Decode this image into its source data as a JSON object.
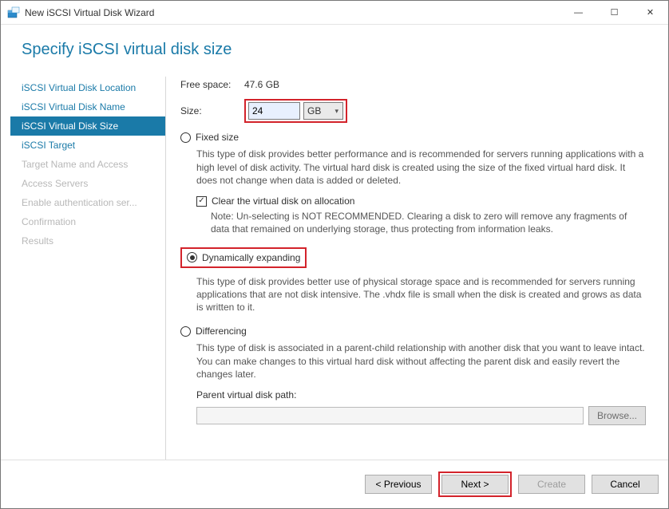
{
  "window": {
    "title": "New iSCSI Virtual Disk Wizard"
  },
  "page": {
    "heading": "Specify iSCSI virtual disk size"
  },
  "sidebar": {
    "items": [
      {
        "label": "iSCSI Virtual Disk Location",
        "state": "enabled"
      },
      {
        "label": "iSCSI Virtual Disk Name",
        "state": "enabled"
      },
      {
        "label": "iSCSI Virtual Disk Size",
        "state": "selected"
      },
      {
        "label": "iSCSI Target",
        "state": "enabled"
      },
      {
        "label": "Target Name and Access",
        "state": "disabled"
      },
      {
        "label": "Access Servers",
        "state": "disabled"
      },
      {
        "label": "Enable authentication ser...",
        "state": "disabled"
      },
      {
        "label": "Confirmation",
        "state": "disabled"
      },
      {
        "label": "Results",
        "state": "disabled"
      }
    ]
  },
  "main": {
    "free_space_label": "Free space:",
    "free_space_value": "47.6 GB",
    "size_label": "Size:",
    "size_value": "24",
    "size_unit": "GB",
    "fixed": {
      "label": "Fixed size",
      "desc": "This type of disk provides better performance and is recommended for servers running applications with a high level of disk activity. The virtual hard disk is created using the size of the fixed virtual hard disk. It does not change when data is added or deleted.",
      "clear_label": "Clear the virtual disk on allocation",
      "clear_note": "Note: Un-selecting is NOT RECOMMENDED. Clearing a disk to zero will remove any fragments of data that remained on underlying storage, thus protecting from information leaks."
    },
    "dynamic": {
      "label": "Dynamically expanding",
      "desc": "This type of disk provides better use of physical storage space and is recommended for servers running applications that are not disk intensive. The .vhdx file is small when the disk is created and grows as data is written to it."
    },
    "diff": {
      "label": "Differencing",
      "desc": "This type of disk is associated in a parent-child relationship with another disk that you want to leave intact. You can make changes to this virtual hard disk without affecting the parent disk and easily revert the changes later.",
      "path_label": "Parent virtual disk path:",
      "browse_label": "Browse..."
    }
  },
  "footer": {
    "previous": "< Previous",
    "next": "Next >",
    "create": "Create",
    "cancel": "Cancel"
  }
}
